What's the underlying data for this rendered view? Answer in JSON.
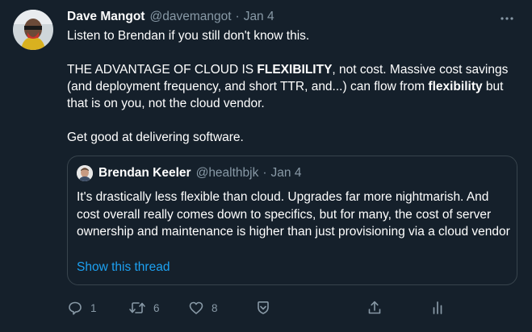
{
  "author": {
    "name": "Dave Mangot",
    "handle": "@davemangot",
    "separator": "·",
    "date": "Jan 4"
  },
  "tweet": {
    "line1": "Listen to Brendan if you still don't know this.",
    "p2_a": "THE ADVANTAGE OF CLOUD IS ",
    "p2_b": "FLEXIBILITY",
    "p2_c": ", not cost. Massive cost savings (and deployment frequency, and short TTR, and...) can flow from ",
    "p2_d": "flexibility",
    "p2_e": " but that is on you, not the cloud vendor.",
    "p3": "Get good at delivering software."
  },
  "quoted": {
    "name": "Brendan Keeler",
    "handle": "@healthbjk",
    "separator": "·",
    "date": "Jan 4",
    "text": "It's drastically less flexible than cloud. Upgrades far more nightmarish. And cost overall really comes down to specifics, but for many, the cost of server ownership and maintenance is higher than just provisioning via a cloud vendor",
    "thread_link": "Show this thread"
  },
  "actions": {
    "reply_count": "1",
    "retweet_count": "6",
    "like_count": "8"
  },
  "icons": {
    "more": "more-horizontal-icon",
    "reply": "reply-icon",
    "retweet": "retweet-icon",
    "like": "heart-icon",
    "bookmark": "bookmark-icon",
    "share": "share-icon",
    "analytics": "analytics-icon"
  },
  "colors": {
    "background": "#15202b",
    "muted": "#8899a6",
    "link": "#1da1f2",
    "border": "#38444d"
  }
}
